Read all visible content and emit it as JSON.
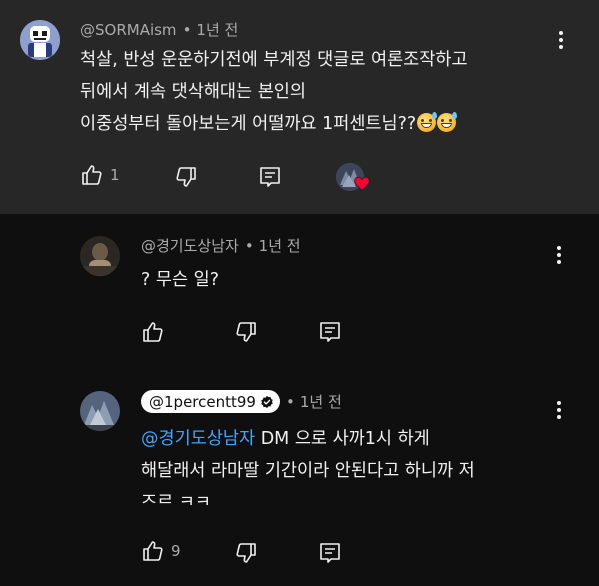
{
  "comments": [
    {
      "handle": "@SORMAism",
      "time": "1년 전",
      "lines": [
        "척살, 반성 운운하기전에 부계정 댓글로 여론조작하고",
        "뒤에서 계속 댓삭해대는 본인의",
        "이중성부터 돌아보는게 어떨까요 1퍼센트님??"
      ],
      "likes": "1"
    },
    {
      "handle": "@경기도상남자",
      "time": "1년 전",
      "lines": [
        "? 무슨 일?"
      ],
      "likes": ""
    },
    {
      "handle": "@1percentt99",
      "time": "1년 전",
      "mention": "@경기도상남자",
      "lines": [
        "DM 으로 사까1시 하게",
        "해달래서 라마딸 기간이라 안된다고 하니까 저",
        "즈르 ㅋㅋ"
      ],
      "likes": "9"
    }
  ],
  "icons": {
    "like": "thumbs-up-icon",
    "dislike": "thumbs-down-icon",
    "reply": "reply-icon",
    "more": "more-vert-icon",
    "heart": "creator-heart-icon",
    "verified": "verified-check-icon",
    "emoji": "grinning-sweat-emoji"
  },
  "colors": {
    "background": "#0f0f0f",
    "highlight": "#272727",
    "text": "#f1f1f1",
    "secondary": "#aaaaaa",
    "mention": "#3ea6ff",
    "heart": "#ff0033"
  }
}
